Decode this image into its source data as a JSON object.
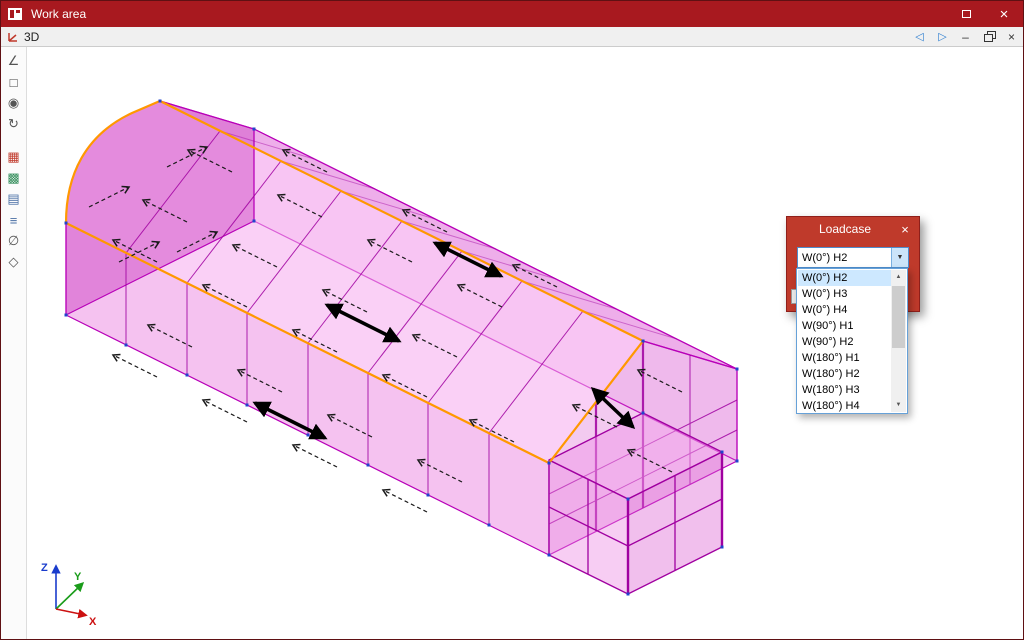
{
  "window": {
    "title": "Work area",
    "close_glyph": "×"
  },
  "viewport": {
    "tab_label": "3D",
    "nav_prev_glyph": "◁",
    "nav_next_glyph": "▷",
    "minimize_glyph": "–",
    "close_glyph": "×"
  },
  "toolbar": {
    "icons": [
      {
        "name": "angle-measure-icon",
        "glyph": "∠",
        "color": "#555555"
      },
      {
        "name": "wireframe-cube-icon",
        "glyph": "□",
        "color": "#444444"
      },
      {
        "name": "visibility-eye-icon",
        "glyph": "◉",
        "color": "#555555"
      },
      {
        "name": "orbit-rotate-icon",
        "glyph": "↻",
        "color": "#555555",
        "gap_after": true
      },
      {
        "name": "load-display-icon",
        "glyph": "▦",
        "color": "#c0392b"
      },
      {
        "name": "surface-display-icon",
        "glyph": "▩",
        "color": "#2e8b57"
      },
      {
        "name": "table-view-icon",
        "glyph": "▤",
        "color": "#4a6fa5"
      },
      {
        "name": "layers-icon",
        "glyph": "≡",
        "color": "#4a6fa5"
      },
      {
        "name": "hide-objects-icon",
        "glyph": "∅",
        "color": "#555555"
      },
      {
        "name": "dimension-3d-icon",
        "glyph": "◇",
        "color": "#555555"
      }
    ]
  },
  "loadcase": {
    "title": "Loadcase",
    "close_glyph": "×",
    "value": "W(0°) H2",
    "dropdown_glyph": "▼",
    "scroll_up_glyph": "▲",
    "scroll_down_glyph": "▼",
    "selected_index": 0,
    "options": [
      "W(0°) H2",
      "W(0°) H3",
      "W(0°) H4",
      "W(90°) H1",
      "W(90°) H2",
      "W(180°) H1",
      "W(180°) H2",
      "W(180°) H3",
      "W(180°) H4"
    ]
  },
  "axes": {
    "x": "X",
    "y": "Y",
    "z": "Z"
  },
  "colors": {
    "titlebar": "#a8191f",
    "dialog_red": "#bf3a2b",
    "selection": "#cde8ff",
    "accent": "#ff9800",
    "magenta": "#b800b8"
  }
}
